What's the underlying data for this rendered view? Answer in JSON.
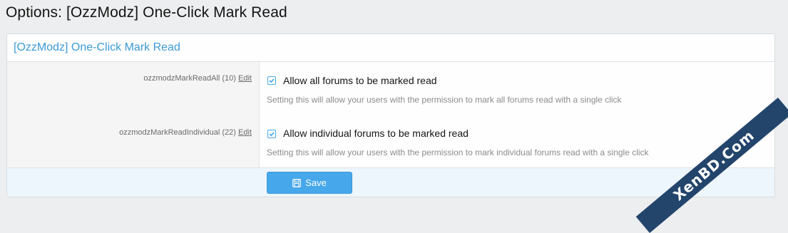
{
  "page": {
    "title": "Options: [OzzModz] One-Click Mark Read"
  },
  "block": {
    "header": "[OzzModz] One-Click Mark Read"
  },
  "options": [
    {
      "key": "ozzmodzMarkReadAll (10)",
      "edit_label": "Edit",
      "checkbox_label": "Allow all forums to be marked read",
      "checked": true,
      "hint": "Setting this will allow your users with the permission to mark all forums read with a single click"
    },
    {
      "key": "ozzmodzMarkReadIndividual (22)",
      "edit_label": "Edit",
      "checkbox_label": "Allow individual forums to be marked read",
      "checked": true,
      "hint": "Setting this will allow your users with the permission to mark individual forums read with a single click"
    }
  ],
  "footer": {
    "save_label": "Save",
    "save_icon": "save-icon"
  },
  "watermark": "XenBD.Com",
  "colors": {
    "accent": "#47a7eb",
    "watermark_bg": "#23446b",
    "footer_bg": "#edf6fd"
  }
}
